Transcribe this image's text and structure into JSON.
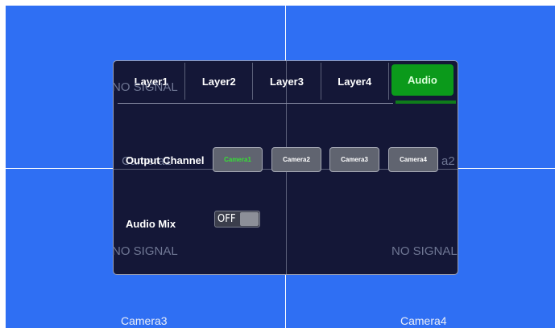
{
  "background_quadrants": {
    "no_signal_text": "NO SIGNAL",
    "camera3_label": "Camera3",
    "camera4_label": "Camera4",
    "camera2_fragment": "a2",
    "camera1_fragment": "Camera1"
  },
  "tabs": [
    {
      "label": "Layer1",
      "active": false
    },
    {
      "label": "Layer2",
      "active": false
    },
    {
      "label": "Layer3",
      "active": false
    },
    {
      "label": "Layer4",
      "active": false
    },
    {
      "label": "Audio",
      "active": true
    }
  ],
  "output_channel": {
    "label": "Output Channel",
    "options": [
      "Camera1",
      "Camera2",
      "Camera3",
      "Camera4"
    ],
    "selected": "Camera1"
  },
  "audio_mix": {
    "label": "Audio Mix",
    "state": "OFF"
  },
  "colors": {
    "background": "#2f6ff3",
    "panel": "#141737",
    "accent_green": "#0b9a1b"
  }
}
